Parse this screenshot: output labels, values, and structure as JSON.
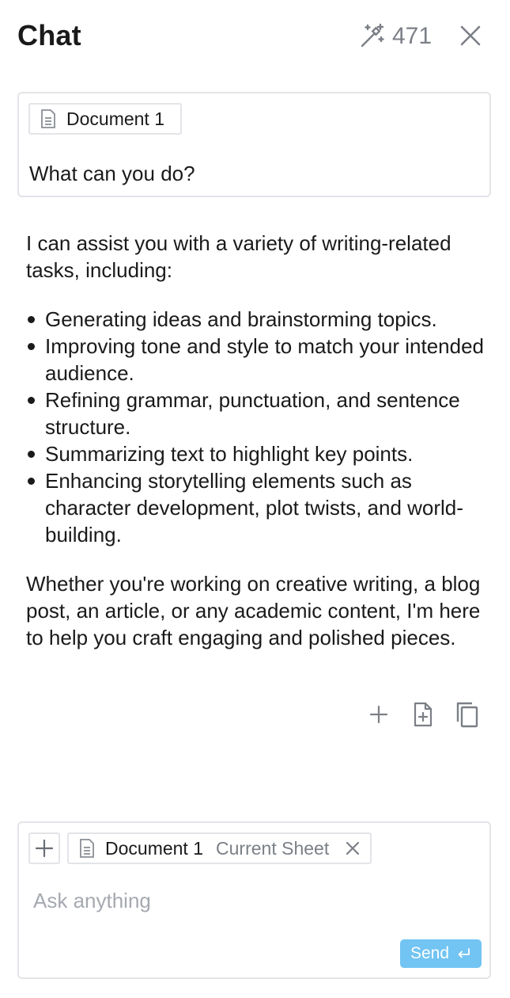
{
  "header": {
    "title": "Chat",
    "credits": "471",
    "credits_icon": "magic-wand-icon",
    "close_icon": "close-icon"
  },
  "conversation": {
    "user_message": {
      "attachment": "Document 1",
      "attachment_icon": "document-icon",
      "text": "What can you do?"
    },
    "assistant_message": {
      "intro": "I can assist you with a variety of writing-related tasks, including:",
      "items": [
        "Generating ideas and brainstorming topics.",
        "Improving tone and style to match your intended audience.",
        "Refining grammar, punctuation, and sentence structure.",
        "Summarizing text to highlight key points.",
        "Enhancing storytelling elements such as character development, plot twists, and world-building."
      ],
      "outro": "Whether you're working on creative writing, a blog post, an article, or any academic content, I'm here to help you craft engaging and polished pieces.",
      "actions": [
        "plus-icon",
        "add-to-document-icon",
        "copy-icon"
      ]
    }
  },
  "composer": {
    "context_doc": "Document 1",
    "context_sub": "Current Sheet",
    "placeholder": "Ask anything",
    "value": "",
    "send_label": "Send",
    "send_icon": "return-icon"
  },
  "colors": {
    "accent": "#72c4f2",
    "muted_text": "#7b7f86",
    "border": "#e2e4e8",
    "placeholder": "#a5a9b0"
  }
}
